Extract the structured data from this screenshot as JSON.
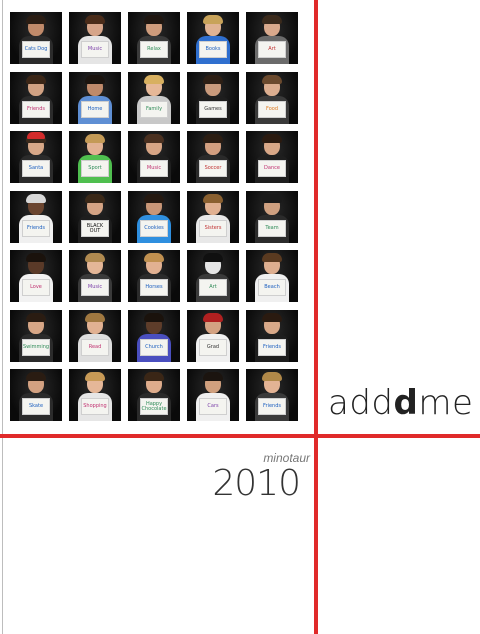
{
  "cover": {
    "title_light_a": "add",
    "title_bold": "d",
    "title_light_b": "me",
    "book_name": "minotaur",
    "year": "2010"
  },
  "colors": {
    "accent_red": "#e02a2a",
    "background": "#ffffff",
    "photo_background": "#111111"
  },
  "portrait_grid": {
    "rows": 7,
    "columns": 5,
    "portraits": [
      {
        "sign": "Cats Dog",
        "skin": "#c08a6a",
        "shirt": "#2b2b2b",
        "hair": "#2a1d14",
        "ink": "#1c5fbf"
      },
      {
        "sign": "Music",
        "skin": "#d6a58a",
        "shirt": "#e5e5e5",
        "hair": "#4a2c1a",
        "ink": "#7a3ea8"
      },
      {
        "sign": "Relax",
        "skin": "#cf9c7c",
        "shirt": "#3a3a3a",
        "hair": "#1f1610",
        "ink": "#2e8b57"
      },
      {
        "sign": "Books",
        "skin": "#e0b394",
        "shirt": "#2f6fcf",
        "hair": "#c8a35a",
        "ink": "#1c5fbf"
      },
      {
        "sign": "Art",
        "skin": "#d9a98c",
        "shirt": "#6b6b6b",
        "hair": "#3a2a1c",
        "ink": "#c03030"
      },
      {
        "sign": "Friends",
        "skin": "#d2a283",
        "shirt": "#2b2b2b",
        "hair": "#3b2617",
        "ink": "#c03070"
      },
      {
        "sign": "Home",
        "skin": "#bf8a6b",
        "shirt": "#5f8fd4",
        "hair": "#1b140f",
        "ink": "#1c5fbf"
      },
      {
        "sign": "Family",
        "skin": "#e6b898",
        "shirt": "#c8c8c8",
        "hair": "#d8b060",
        "ink": "#2e8b57"
      },
      {
        "sign": "Games",
        "skin": "#c99a7c",
        "shirt": "#1e1e1e",
        "hair": "#2d1f15",
        "ink": "#333333"
      },
      {
        "sign": "Food",
        "skin": "#dcae90",
        "shirt": "#3a3a3a",
        "hair": "#6b4a2e",
        "ink": "#e07b20"
      },
      {
        "sign": "Santa",
        "skin": "#d8a888",
        "shirt": "#2b2b2b",
        "hair": "#3b2a1c",
        "ink": "#1c5fbf"
      },
      {
        "sign": "Sport",
        "skin": "#e2b293",
        "shirt": "#4fbf4f",
        "hair": "#c49a56",
        "ink": "#2e8b57"
      },
      {
        "sign": "Music",
        "skin": "#d7a585",
        "shirt": "#1f1f1f",
        "hair": "#4a3020",
        "ink": "#c03070"
      },
      {
        "sign": "Soccer",
        "skin": "#d39f80",
        "shirt": "#2a2a2a",
        "hair": "#2b1d13",
        "ink": "#c03030"
      },
      {
        "sign": "Dance",
        "skin": "#d8a787",
        "shirt": "#1e1e1e",
        "hair": "#2a1a10",
        "ink": "#c03070"
      },
      {
        "sign": "Friends",
        "skin": "#6b4530",
        "shirt": "#f0f0f0",
        "hair": "#d8d8d8",
        "ink": "#1c5fbf"
      },
      {
        "sign": "BLACK OUT",
        "skin": "#d4a384",
        "shirt": "#1e1e1e",
        "hair": "#3a2818",
        "ink": "#111111"
      },
      {
        "sign": "Cookies",
        "skin": "#c99677",
        "shirt": "#2f8fdf",
        "hair": "#241810",
        "ink": "#1c5fbf"
      },
      {
        "sign": "Sisters",
        "skin": "#e0b091",
        "shirt": "#e8e8e8",
        "hair": "#8a6030",
        "ink": "#c03030"
      },
      {
        "sign": "Team",
        "skin": "#cfa080",
        "shirt": "#2b2b2b",
        "hair": "#1a1a1a",
        "ink": "#2e8b57"
      },
      {
        "sign": "Love",
        "skin": "#5a3a28",
        "shirt": "#f2f2f2",
        "hair": "#1a120c",
        "ink": "#c03070"
      },
      {
        "sign": "Music",
        "skin": "#e4b697",
        "shirt": "#3a3a3a",
        "hair": "#b08a50",
        "ink": "#7a3ea8"
      },
      {
        "sign": "Horses",
        "skin": "#e2b192",
        "shirt": "#2b2b2b",
        "hair": "#c09050",
        "ink": "#1c5fbf"
      },
      {
        "sign": "Art",
        "skin": "#e6e6e6",
        "shirt": "#3a3a3a",
        "hair": "#101010",
        "ink": "#2e8b57"
      },
      {
        "sign": "Beach",
        "skin": "#deae8f",
        "shirt": "#f0f0f0",
        "hair": "#5a3a20",
        "ink": "#1c5fbf"
      },
      {
        "sign": "Swimming",
        "skin": "#d7a686",
        "shirt": "#2b2b2b",
        "hair": "#2a1c12",
        "ink": "#2e8b57"
      },
      {
        "sign": "Read",
        "skin": "#e1b192",
        "shirt": "#dedede",
        "hair": "#a07840",
        "ink": "#c03070"
      },
      {
        "sign": "Church",
        "skin": "#5e3d2a",
        "shirt": "#4a4fbf",
        "hair": "#1a120c",
        "ink": "#1c5fbf"
      },
      {
        "sign": "Grad",
        "skin": "#d4a282",
        "shirt": "#f0f0f0",
        "hair": "#b02020",
        "ink": "#333333"
      },
      {
        "sign": "Friends",
        "skin": "#d9a888",
        "shirt": "#1e1e1e",
        "hair": "#2a1a10",
        "ink": "#1c5fbf"
      },
      {
        "sign": "Skate",
        "skin": "#d3a181",
        "shirt": "#2b2b2b",
        "hair": "#2a1c12",
        "ink": "#1c5fbf"
      },
      {
        "sign": "Shopping",
        "skin": "#e5b798",
        "shirt": "#e6e6e6",
        "hair": "#c89a56",
        "ink": "#c03070"
      },
      {
        "sign": "Happy Chocolate",
        "skin": "#deac8c",
        "shirt": "#2a2a2a",
        "hair": "#3a2616",
        "ink": "#2e8b57"
      },
      {
        "sign": "Cars",
        "skin": "#d0a07e",
        "shirt": "#f0f0f0",
        "hair": "#1b140f",
        "ink": "#7a3ea8"
      },
      {
        "sign": "Friends",
        "skin": "#e3b394",
        "shirt": "#3a3a3a",
        "hair": "#b08848",
        "ink": "#1c5fbf"
      }
    ]
  }
}
